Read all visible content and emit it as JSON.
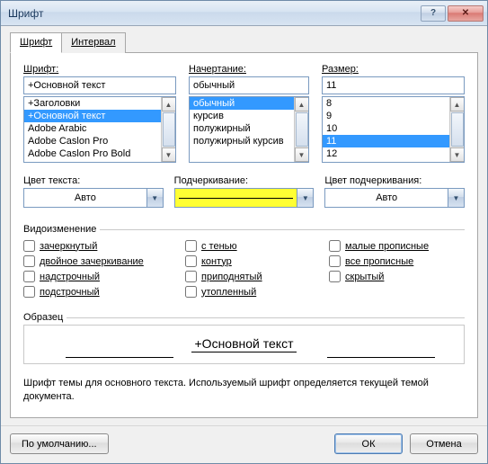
{
  "window": {
    "title": "Шрифт"
  },
  "tabs": {
    "font": "Шрифт",
    "spacing": "Интервал"
  },
  "labels": {
    "font": "Шрифт:",
    "style": "Начертание:",
    "size": "Размер:",
    "textColor": "Цвет текста:",
    "underline": "Подчеркивание:",
    "underlineColor": "Цвет подчеркивания:",
    "effects": "Видоизменение",
    "sample": "Образец"
  },
  "font": {
    "value": "+Основной текст",
    "options": [
      "+Заголовки",
      "+Основной текст",
      "Adobe Arabic",
      "Adobe Caslon Pro",
      "Adobe Caslon Pro Bold"
    ]
  },
  "style": {
    "value": "обычный",
    "options": [
      "обычный",
      "курсив",
      "полужирный",
      "полужирный курсив"
    ]
  },
  "size": {
    "value": "11",
    "options": [
      "8",
      "9",
      "10",
      "11",
      "12"
    ]
  },
  "combos": {
    "textColor": "Авто",
    "underlineColor": "Авто"
  },
  "checks": {
    "strike": "зачеркнутый",
    "dstrike": "двойное зачеркивание",
    "superscript": "надстрочный",
    "subscript": "подстрочный",
    "shadow": "с тенью",
    "outline": "контур",
    "emboss": "приподнятый",
    "engrave": "утопленный",
    "smallcaps": "малые прописные",
    "allcaps": "все прописные",
    "hidden": "скрытый"
  },
  "sample": {
    "text": "+Основной текст"
  },
  "description": "Шрифт темы для основного текста. Используемый шрифт определяется текущей темой документа.",
  "buttons": {
    "defaults": "По умолчанию...",
    "ok": "ОК",
    "cancel": "Отмена"
  }
}
